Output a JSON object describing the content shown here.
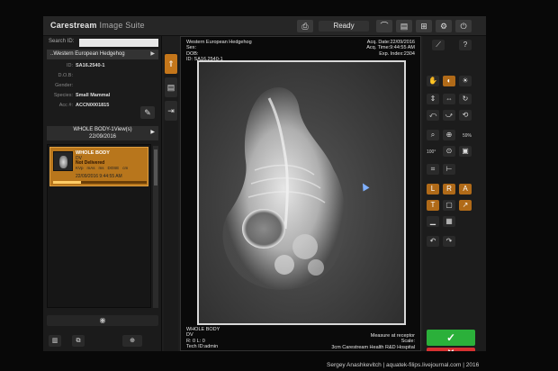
{
  "app": {
    "brand": "Carestream",
    "brand_sub": "Image Suite",
    "status": "Ready"
  },
  "search": {
    "label": "Search ID:",
    "value": ""
  },
  "patient": {
    "name": "..Western European Hedgehog",
    "fields": [
      {
        "k": "ID:",
        "v": "SA16.2540-1"
      },
      {
        "k": "D.O.B:",
        "v": ""
      },
      {
        "k": "Gender:",
        "v": ""
      },
      {
        "k": "Species:",
        "v": "Small Mammal"
      },
      {
        "k": "Acc #:",
        "v": "ACCN0001815"
      }
    ]
  },
  "study": {
    "line1": "WHOLE BODY-1View(s)",
    "line2": "22/09/2016"
  },
  "series_card": {
    "title": "WHOLE BODY",
    "view": "DV",
    "status": "Not Delivered",
    "cols": [
      "KVp",
      "mAs",
      "ms",
      "DOSE",
      "cm"
    ],
    "date": "22/09/2016 9:44:55 AM",
    "progress": 0.3
  },
  "viewer": {
    "top_left": [
      "Western European Hedgehog",
      "Sex:",
      "DOB:",
      "ID: SA16.2540-1"
    ],
    "top_right": [
      "Acq. Date:22/09/2016",
      "Acq. Time:9:44:55 AM",
      "Exp. Index:2304"
    ],
    "bottom_left": [
      "WHOLE BODY",
      "DV",
      "R: 0 L: 0",
      "Tech ID:admin"
    ],
    "bottom_right": [
      "Measure at receptor",
      "Scale:",
      "3cm Carestream Health R&D Hospital"
    ]
  },
  "toolbox": {
    "zoom_percent": "59%",
    "fit_label": "100°"
  },
  "credit": "Sergey Anashkevitch | aquatek-filips.livejournal.com | 2016",
  "colors": {
    "accent": "#c4761a",
    "accept": "#2bb03a",
    "reject": "#d63131"
  }
}
